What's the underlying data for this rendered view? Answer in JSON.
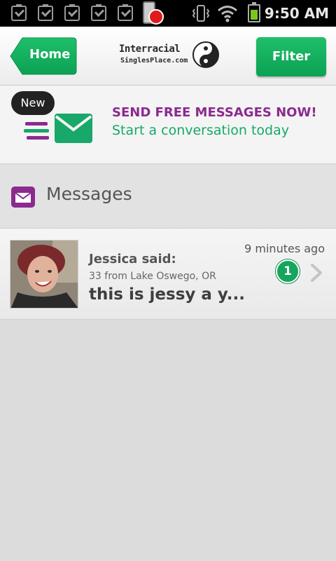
{
  "status_bar": {
    "time": "9:50 AM",
    "icons": [
      "clipboard-check-icon",
      "clipboard-check-icon",
      "clipboard-check-icon",
      "clipboard-check-icon",
      "clipboard-check-icon",
      "phone-record-icon",
      "vibrate-icon",
      "wifi-icon",
      "battery-icon"
    ]
  },
  "header": {
    "home_label": "Home",
    "filter_label": "Filter",
    "logo": {
      "line1": "Interracial",
      "line2": "SinglesPlace.com"
    },
    "colors": {
      "accent_green": "#0ca154",
      "purple": "#8b2a8f"
    }
  },
  "banner": {
    "badge": "New",
    "title": "SEND FREE MESSAGES NOW!",
    "subtitle": "Start a conversation today"
  },
  "section": {
    "title": "Messages"
  },
  "messages": [
    {
      "name": "Jessica said:",
      "location": "33 from Lake Oswego, OR",
      "preview": "this is jessy a y...",
      "time": "9 minutes ago",
      "count": "1"
    }
  ]
}
